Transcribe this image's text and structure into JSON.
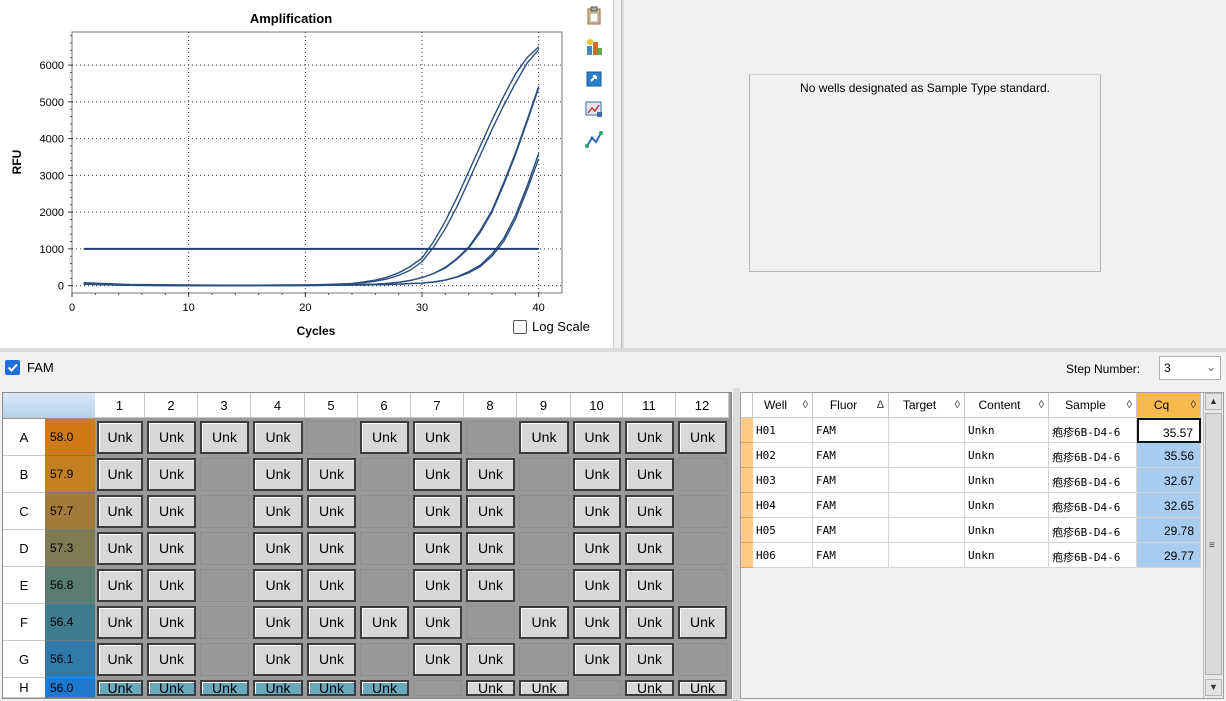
{
  "chart": {
    "title": "Amplification",
    "x_label": "Cycles",
    "y_label": "RFU",
    "log_scale_label": "Log Scale",
    "log_scale_checked": false
  },
  "chart_data": {
    "type": "line",
    "title": "Amplification",
    "xlabel": "Cycles",
    "ylabel": "RFU",
    "xlim": [
      0,
      42
    ],
    "ylim": [
      -200,
      6900
    ],
    "xticks": [
      "0",
      "10",
      "20",
      "30",
      "40"
    ],
    "yticks": [
      "0",
      "1000",
      "2000",
      "3000",
      "4000",
      "5000",
      "6000"
    ],
    "grid": "dotted",
    "threshold": 1000,
    "x": [
      1,
      5,
      10,
      15,
      20,
      22,
      24,
      25,
      26,
      27,
      28,
      29,
      30,
      31,
      32,
      33,
      34,
      35,
      36,
      37,
      38,
      39,
      40
    ],
    "series": [
      {
        "color": "#2b4f7e",
        "values": [
          80,
          30,
          20,
          10,
          20,
          30,
          60,
          100,
          150,
          230,
          350,
          520,
          750,
          1200,
          1750,
          2400,
          3100,
          3800,
          4500,
          5150,
          5750,
          6200,
          6500
        ]
      },
      {
        "color": "#2b4f7e",
        "values": [
          60,
          20,
          10,
          10,
          20,
          30,
          50,
          80,
          120,
          180,
          280,
          420,
          650,
          1050,
          1550,
          2150,
          2850,
          3550,
          4250,
          4900,
          5500,
          6050,
          6420
        ]
      },
      {
        "color": "#2b4f7e",
        "values": [
          50,
          10,
          0,
          5,
          10,
          20,
          25,
          30,
          40,
          60,
          90,
          140,
          220,
          330,
          500,
          740,
          1050,
          1500,
          2050,
          2800,
          3600,
          4500,
          5420
        ]
      },
      {
        "color": "#2b4f7e",
        "values": [
          50,
          10,
          0,
          5,
          10,
          20,
          25,
          30,
          40,
          60,
          90,
          140,
          220,
          330,
          480,
          720,
          1020,
          1450,
          2000,
          2750,
          3550,
          4450,
          5380
        ]
      },
      {
        "color": "#2b4f7e",
        "values": [
          40,
          10,
          0,
          0,
          5,
          10,
          15,
          20,
          25,
          30,
          40,
          55,
          70,
          100,
          150,
          230,
          350,
          520,
          800,
          1200,
          1800,
          2600,
          3450
        ]
      },
      {
        "color": "#2b4f7e",
        "values": [
          40,
          10,
          0,
          0,
          5,
          10,
          15,
          20,
          25,
          30,
          40,
          55,
          70,
          100,
          150,
          240,
          380,
          560,
          860,
          1280,
          1900,
          2700,
          3600
        ]
      }
    ]
  },
  "standard_curve": {
    "message": "No wells designated as Sample Type standard."
  },
  "fluor": {
    "label": "FAM",
    "checked": true,
    "step_label": "Step Number:",
    "step_value": "3"
  },
  "plate": {
    "columns": [
      "1",
      "2",
      "3",
      "4",
      "5",
      "6",
      "7",
      "8",
      "9",
      "10",
      "11",
      "12"
    ],
    "rows": [
      {
        "label": "A",
        "temp": "58.0",
        "temp_color": "#cf7a16",
        "wells": [
          1,
          1,
          1,
          1,
          0,
          1,
          1,
          0,
          1,
          1,
          1,
          1
        ]
      },
      {
        "label": "B",
        "temp": "57.9",
        "temp_color": "#c38021",
        "wells": [
          1,
          1,
          0,
          1,
          1,
          0,
          1,
          1,
          0,
          1,
          1,
          0
        ]
      },
      {
        "label": "C",
        "temp": "57.7",
        "temp_color": "#a27a3a",
        "wells": [
          1,
          1,
          0,
          1,
          1,
          0,
          1,
          1,
          0,
          1,
          1,
          0
        ]
      },
      {
        "label": "D",
        "temp": "57.3",
        "temp_color": "#7f7b55",
        "wells": [
          1,
          1,
          0,
          1,
          1,
          0,
          1,
          1,
          0,
          1,
          1,
          0
        ]
      },
      {
        "label": "E",
        "temp": "56.8",
        "temp_color": "#5b7c71",
        "wells": [
          1,
          1,
          0,
          1,
          1,
          0,
          1,
          1,
          0,
          1,
          1,
          0
        ]
      },
      {
        "label": "F",
        "temp": "56.4",
        "temp_color": "#3e7c8e",
        "wells": [
          1,
          1,
          0,
          1,
          1,
          1,
          1,
          0,
          1,
          1,
          1,
          1
        ]
      },
      {
        "label": "G",
        "temp": "56.1",
        "temp_color": "#2f7aa8",
        "wells": [
          1,
          1,
          0,
          1,
          1,
          0,
          1,
          1,
          0,
          1,
          1,
          0
        ]
      },
      {
        "label": "H",
        "temp": "56.0",
        "temp_color": "#1f79cf",
        "wells": [
          1,
          1,
          1,
          1,
          1,
          1,
          0,
          1,
          1,
          0,
          1,
          1
        ],
        "selected": [
          1,
          1,
          1,
          1,
          1,
          1,
          0,
          0,
          0,
          0,
          0,
          0
        ]
      }
    ],
    "well_label": "Unk"
  },
  "results": {
    "columns": [
      {
        "label": "Well",
        "sort": "◊"
      },
      {
        "label": "Fluor",
        "sort": "Δ"
      },
      {
        "label": "Target",
        "sort": "◊"
      },
      {
        "label": "Content",
        "sort": "◊"
      },
      {
        "label": "Sample",
        "sort": "◊"
      },
      {
        "label": "Cq",
        "sort": "◊"
      }
    ],
    "rows": [
      {
        "well": "H01",
        "fluor": "FAM",
        "target": "",
        "content": "Unkn",
        "sample": "疱疹6B-D4-6",
        "cq": "35.57"
      },
      {
        "well": "H02",
        "fluor": "FAM",
        "target": "",
        "content": "Unkn",
        "sample": "疱疹6B-D4-6",
        "cq": "35.56"
      },
      {
        "well": "H03",
        "fluor": "FAM",
        "target": "",
        "content": "Unkn",
        "sample": "疱疹6B-D4-6",
        "cq": "32.67"
      },
      {
        "well": "H04",
        "fluor": "FAM",
        "target": "",
        "content": "Unkn",
        "sample": "疱疹6B-D4-6",
        "cq": "32.65"
      },
      {
        "well": "H05",
        "fluor": "FAM",
        "target": "",
        "content": "Unkn",
        "sample": "疱疹6B-D4-6",
        "cq": "29.78"
      },
      {
        "well": "H06",
        "fluor": "FAM",
        "target": "",
        "content": "Unkn",
        "sample": "疱疹6B-D4-6",
        "cq": "29.77"
      }
    ]
  },
  "icons": {
    "toolbar": [
      "clipboard-icon",
      "chart-options-icon",
      "export-icon",
      "chart-image-icon",
      "trace-styles-icon"
    ]
  }
}
